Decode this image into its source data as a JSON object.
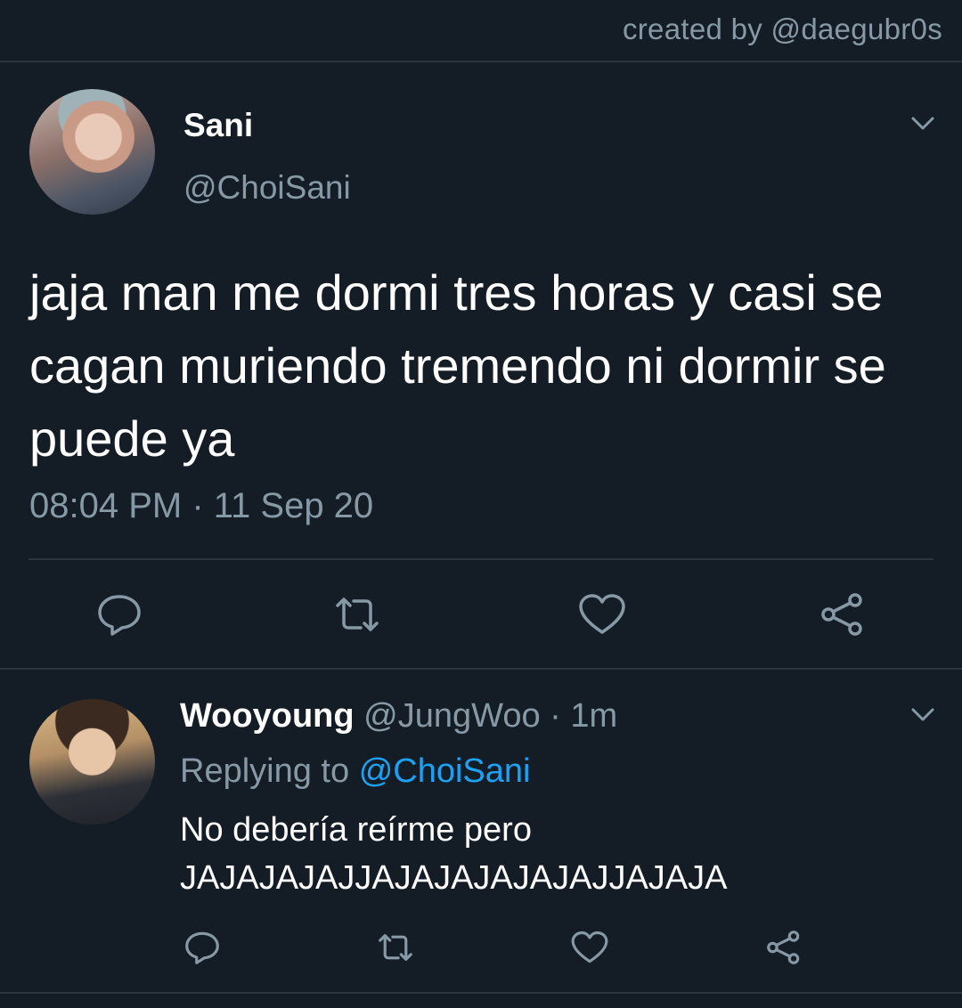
{
  "credit": "created by @daegubr0s",
  "tweet": {
    "name": "Sani",
    "handle": "@ChoiSani",
    "text": "jaja man me dormi tres horas y casi se cagan muriendo tremendo ni dormir se puede ya",
    "timestamp": "08:04 PM · 11 Sep 20"
  },
  "reply": {
    "name": "Wooyoung",
    "handle": "@JungWoo",
    "time": "· 1m",
    "replying_label": "Replying to",
    "replying_to": "@ChoiSani",
    "text_line1": "No debería reírme pero",
    "text_line2": "JAJAJAJAJJAJAJAJAJAJAJJAJAJA"
  },
  "icons": [
    "reply-icon",
    "retweet-icon",
    "like-icon",
    "share-icon",
    "chevron-down-icon"
  ],
  "colors": {
    "background": "#141d26",
    "muted": "#8899a6",
    "accent": "#1da1f2",
    "divider": "#2b3640"
  }
}
